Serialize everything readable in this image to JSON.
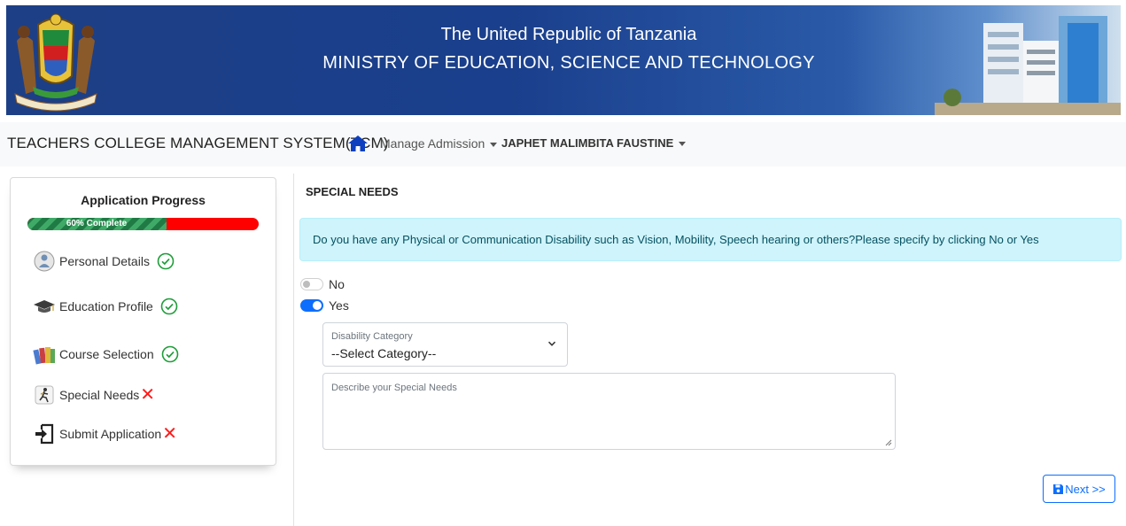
{
  "header": {
    "line1": "The United Republic of Tanzania",
    "line2": "MINISTRY OF EDUCATION, SCIENCE AND TECHNOLOGY",
    "emblem_icon": "coat-of-arms-icon",
    "building_image": "ministry-building-image"
  },
  "navbar": {
    "brand": "TEACHERS COLLEGE MANAGEMENT SYSTEM(TCM)",
    "home_icon": "home-icon",
    "manage_menu": "Manage Admission",
    "user_menu": "JAPHET MALIMBITA FAUSTINE"
  },
  "progress_card": {
    "title": "Application Progress",
    "progress_label": "60% Complete",
    "progress_percent": 60,
    "steps": [
      {
        "label": "Personal Details",
        "status": "complete",
        "icon": "person-icon"
      },
      {
        "label": "Education Profile",
        "status": "complete",
        "icon": "graduation-cap-icon"
      },
      {
        "label": "Course Selection",
        "status": "complete",
        "icon": "books-icon"
      },
      {
        "label": "Special Needs",
        "status": "incomplete",
        "icon": "accessibility-icon"
      },
      {
        "label": "Submit Application",
        "status": "incomplete",
        "icon": "sign-in-icon"
      }
    ]
  },
  "main": {
    "section_title": "SPECIAL NEEDS",
    "alert": "Do you have any Physical or Communication Disability such as Vision, Mobility, Speech hearing or others?Please specify by clicking No or Yes",
    "options": [
      {
        "label": "No",
        "checked": false
      },
      {
        "label": "Yes",
        "checked": true
      }
    ],
    "disability_category": {
      "label": "Disability Category",
      "value": "--Select Category--"
    },
    "description": {
      "label": "Describe your Special Needs",
      "value": ""
    },
    "next_button": "Next >>"
  },
  "colors": {
    "accent": "#0d6efd",
    "banner": "#1d3f86",
    "progress_done": "#2e8b57",
    "progress_remaining": "#ff0000",
    "alert_bg": "#cff4fc",
    "error": "#ff1a1a"
  }
}
